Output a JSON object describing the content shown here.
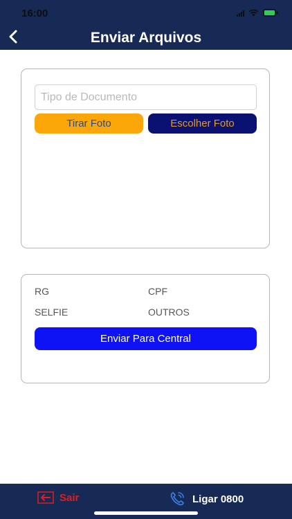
{
  "status_bar": {
    "time": "16:00"
  },
  "header": {
    "title": "Enviar Arquivos"
  },
  "upload_card": {
    "document_type_placeholder": "Tipo de Documento",
    "take_photo_label": "Tirar Foto",
    "choose_photo_label": "Escolher Foto"
  },
  "documents_card": {
    "items": [
      "RG",
      "CPF",
      "SELFIE",
      "OUTROS"
    ],
    "send_label": "Enviar Para Central"
  },
  "footer": {
    "logout_label": "Sair",
    "call_label": "Ligar 0800"
  },
  "icons": {
    "back": "chevron-left-icon",
    "logout": "logout-arrow-icon",
    "call": "phone-icon"
  },
  "colors": {
    "header_bg": "#172a56",
    "take_photo_bg": "#fba70a",
    "choose_photo_bg": "#0a1170",
    "send_bg": "#0f12f4",
    "logout_red": "#e11d1d"
  }
}
